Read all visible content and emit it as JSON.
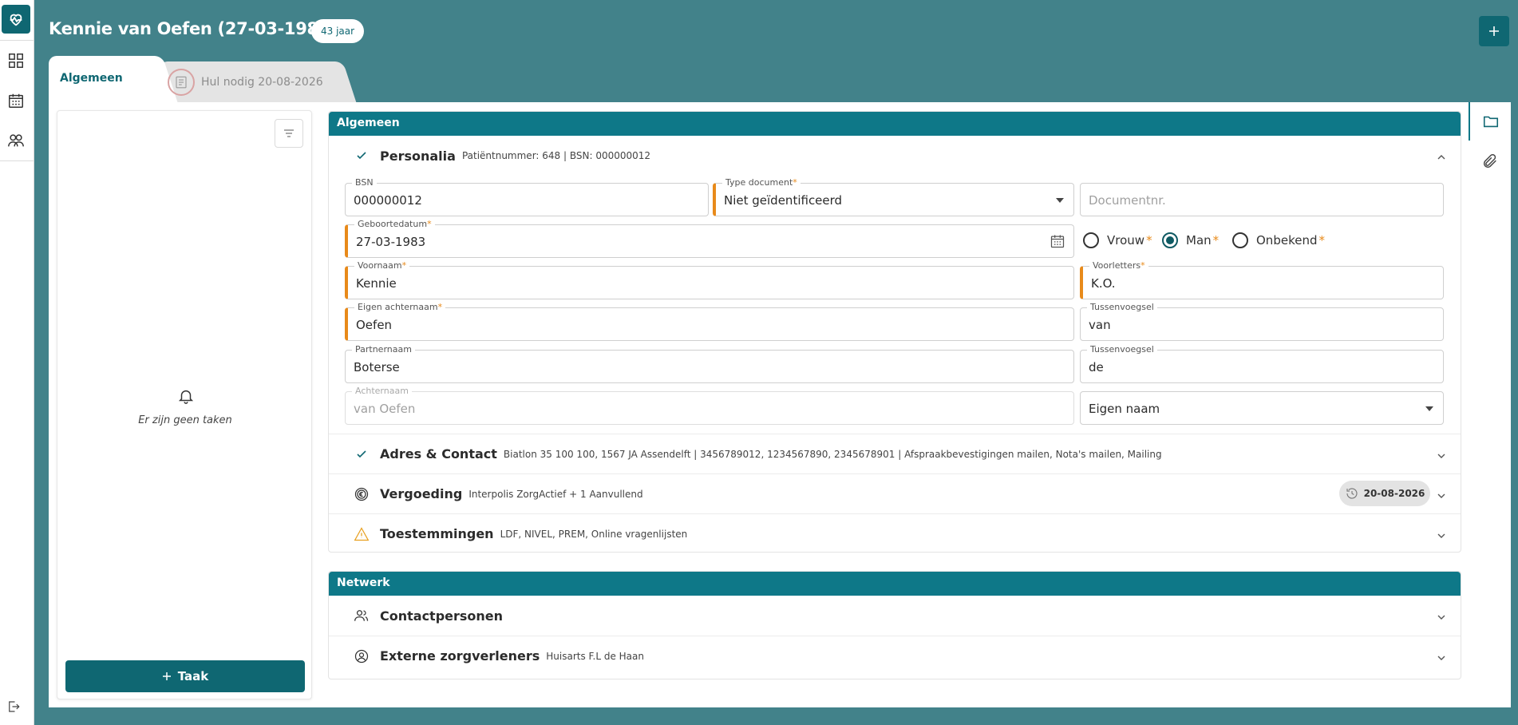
{
  "header": {
    "title": "Kennie van Oefen (27-03-1983) M",
    "age_badge": "43 jaar"
  },
  "tabs": [
    {
      "label": "Algemeen",
      "active": true
    },
    {
      "label": "Hul nodig  20-08-2026",
      "active": false
    }
  ],
  "tasks": {
    "empty_text": "Er zijn geen taken",
    "add_button": "Taak"
  },
  "algemeen": {
    "header": "Algemeen",
    "personalia": {
      "title": "Personalia",
      "subtitle": "Patiëntnummer: 648 | BSN: 000000012"
    },
    "fields": {
      "bsn": {
        "label": "BSN",
        "value": "000000012"
      },
      "type_document": {
        "label": "Type document",
        "value": "Niet geïdentificeerd"
      },
      "documentnr": {
        "placeholder": "Documentnr."
      },
      "geboortedatum": {
        "label": "Geboortedatum",
        "value": "27-03-1983"
      },
      "voornaam": {
        "label": "Voornaam",
        "value": "Kennie"
      },
      "voorletters": {
        "label": "Voorletters",
        "value": "K.O."
      },
      "eigen_achternaam": {
        "label": "Eigen achternaam",
        "value": "Oefen"
      },
      "tussenvoegsel1": {
        "label": "Tussenvoegsel",
        "value": "van"
      },
      "partnernaam": {
        "label": "Partnernaam",
        "value": "Boterse"
      },
      "tussenvoegsel2": {
        "label": "Tussenvoegsel",
        "value": "de"
      },
      "achternaam": {
        "label": "Achternaam",
        "value": "van Oefen"
      },
      "naamgebruik": {
        "value": "Eigen naam"
      }
    },
    "gender": {
      "options": [
        "Vrouw",
        "Man",
        "Onbekend"
      ],
      "selected": "Man"
    },
    "adres": {
      "title": "Adres & Contact",
      "subtitle": "Biatlon 35 100 100, 1567 JA Assendelft | 3456789012, 1234567890, 2345678901 | Afspraakbevestigingen mailen, Nota's mailen, Mailing"
    },
    "vergoeding": {
      "title": "Vergoeding",
      "subtitle": "Interpolis ZorgActief + 1 Aanvullend",
      "date": "20-08-2026"
    },
    "toestemmingen": {
      "title": "Toestemmingen",
      "subtitle": "LDF, NIVEL, PREM, Online vragenlijsten"
    }
  },
  "netwerk": {
    "header": "Netwerk",
    "contactpersonen": {
      "title": "Contactpersonen"
    },
    "externe": {
      "title": "Externe zorgverleners",
      "subtitle": "Huisarts F.L de Haan"
    }
  },
  "colors": {
    "background": "#42828a",
    "primary": "#0f6772",
    "section_header": "#0e7888",
    "required": "#e88a1a"
  }
}
